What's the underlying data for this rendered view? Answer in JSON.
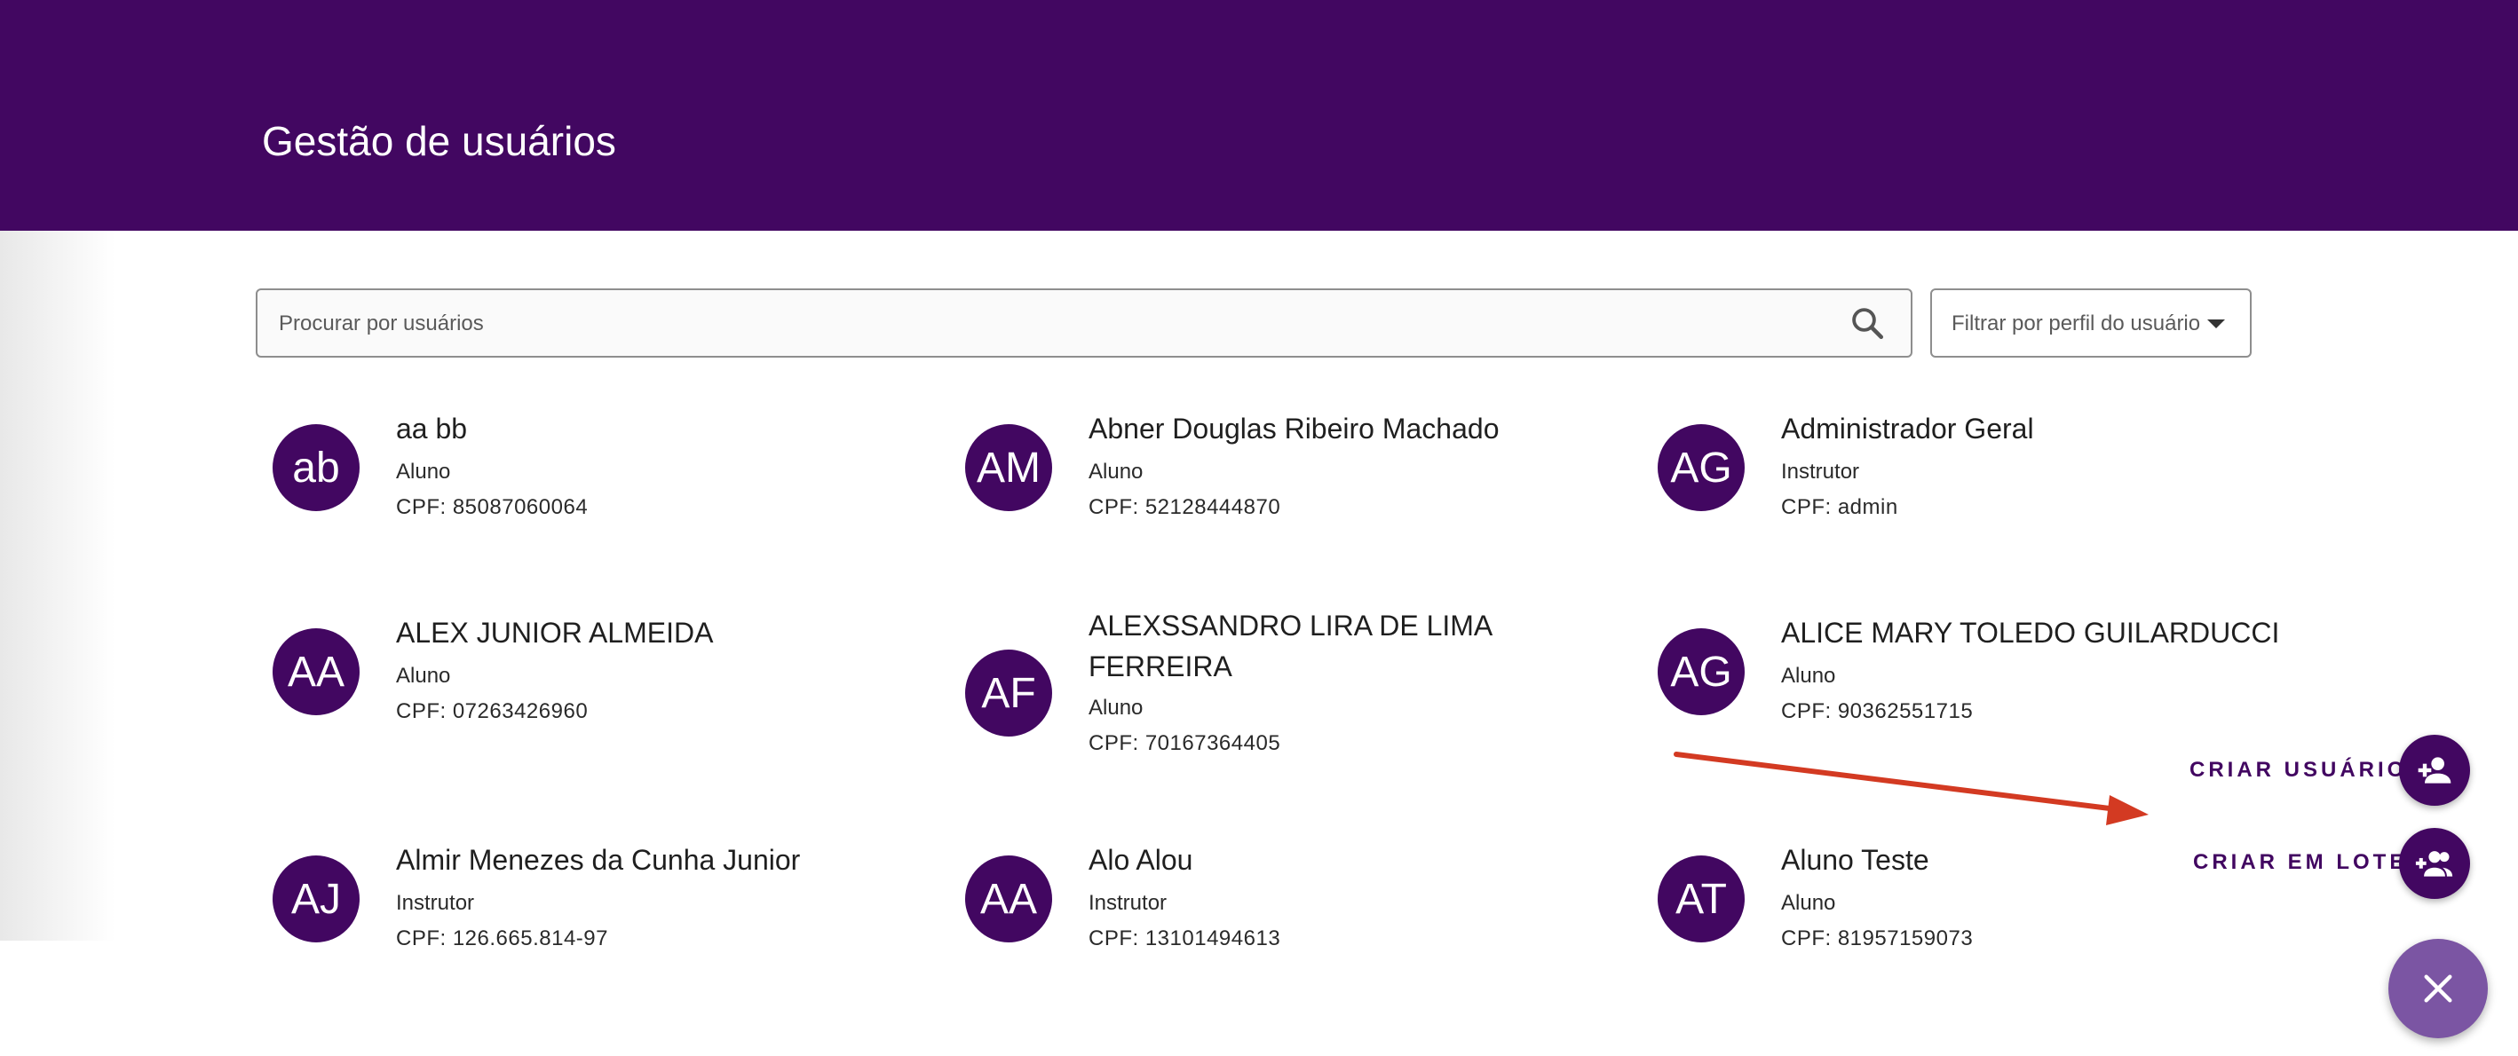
{
  "header": {
    "title": "Gestão de usuários",
    "background_color": "#420761"
  },
  "search": {
    "placeholder": "Procurar por usuários",
    "icon": "search-icon"
  },
  "filter": {
    "label": "Filtrar por perfil do usuário",
    "icon": "chevron-down-icon"
  },
  "users": [
    {
      "initials": "ab",
      "name": "aa bb",
      "role": "Aluno",
      "cpf": "CPF: 85087060064"
    },
    {
      "initials": "AM",
      "name": "Abner Douglas Ribeiro Machado",
      "role": "Aluno",
      "cpf": "CPF: 52128444870"
    },
    {
      "initials": "AG",
      "name": "Administrador Geral",
      "role": "Instrutor",
      "cpf": "CPF: admin"
    },
    {
      "initials": "AA",
      "name": "ALEX JUNIOR ALMEIDA",
      "role": "Aluno",
      "cpf": "CPF: 07263426960"
    },
    {
      "initials": "AF",
      "name": "ALEXSSANDRO LIRA DE LIMA FERREIRA",
      "role": "Aluno",
      "cpf": "CPF: 70167364405"
    },
    {
      "initials": "AG",
      "name": "ALICE MARY TOLEDO GUILARDUCCI",
      "role": "Aluno",
      "cpf": "CPF: 90362551715"
    },
    {
      "initials": "AJ",
      "name": "Almir Menezes da Cunha Junior",
      "role": "Instrutor",
      "cpf": "CPF: 126.665.814-97"
    },
    {
      "initials": "AA",
      "name": "Alo Alou",
      "role": "Instrutor",
      "cpf": "CPF: 13101494613"
    },
    {
      "initials": "AT",
      "name": "Aluno Teste",
      "role": "Aluno",
      "cpf": "CPF: 81957159073"
    }
  ],
  "fab_menu": {
    "create_user_label": "CRIAR USUÁRIO",
    "create_batch_label": "CRIAR EM LOTE",
    "create_user_icon": "person-add-icon",
    "create_batch_icon": "group-add-icon",
    "close_icon": "close-icon",
    "accent_color": "#420761",
    "main_fab_color": "#7b55a3"
  },
  "annotation": {
    "arrow_color": "#d33a22"
  }
}
